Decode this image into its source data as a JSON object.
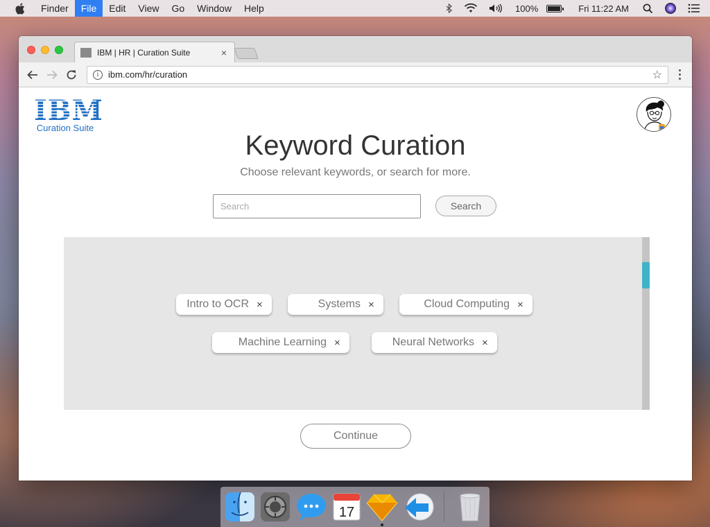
{
  "menubar": {
    "app_name": "Finder",
    "items": [
      "File",
      "Edit",
      "View",
      "Go",
      "Window",
      "Help"
    ],
    "active_item": "File",
    "battery": "100%",
    "clock": "Fri 11:22 AM"
  },
  "browser": {
    "tab_title": "IBM | HR | Curation Suite",
    "url": "ibm.com/hr/curation"
  },
  "page": {
    "logo_text": "IBM",
    "logo_subtitle": "Curation Suite",
    "title": "Keyword Curation",
    "subtitle": "Choose relevant keywords, or search for more.",
    "search_placeholder": "Search",
    "search_button": "Search",
    "keywords": [
      "Intro to OCR",
      "Systems",
      "Cloud Computing",
      "Machine Learning",
      "Neural Networks"
    ],
    "continue_button": "Continue",
    "scroll_position": 0.17
  },
  "dock": {
    "apps": [
      "finder",
      "launchpad",
      "messages",
      "calendar",
      "sketch",
      "marvel"
    ],
    "calendar_day": "17"
  },
  "colors": {
    "ibm_blue": "#1f6fc3",
    "scroll_accent": "#3fb3c9",
    "menu_highlight": "#2f7ff3"
  }
}
